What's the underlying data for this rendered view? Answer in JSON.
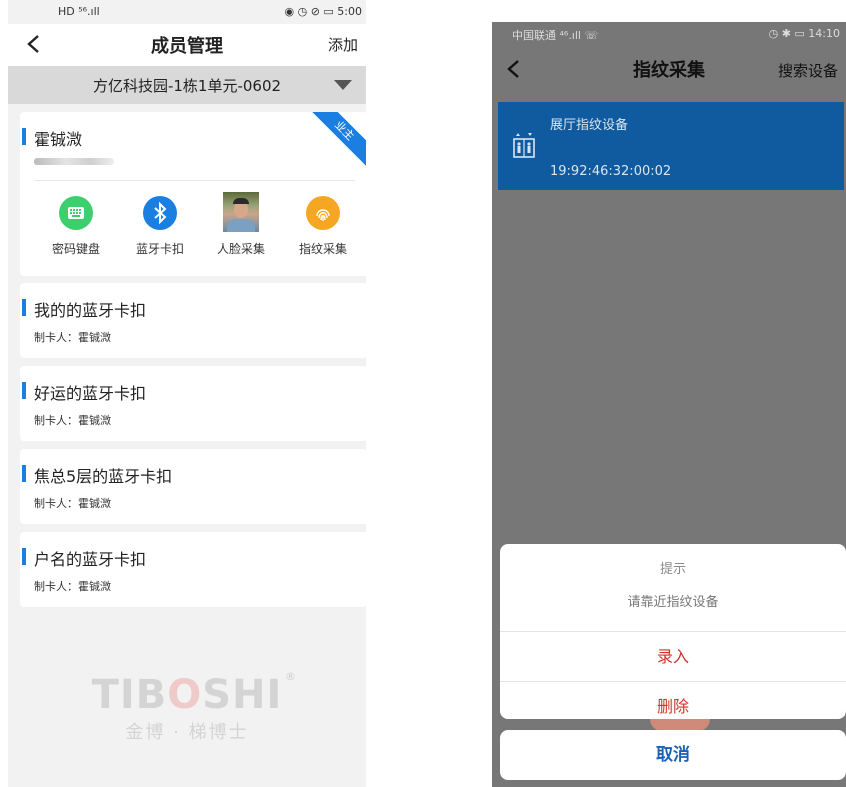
{
  "left": {
    "status": {
      "left": "HD ⁵⁶.ıll",
      "right": "◉ ◷ ⊘ ▭ 5:00"
    },
    "nav": {
      "title": "成员管理",
      "action": "添加"
    },
    "unit_select": "方亿科技园-1栋1单元-0602",
    "member": {
      "name": "霍铖溦",
      "badge": "业主",
      "functions": [
        {
          "label": "密码键盘",
          "icon": "keypad-icon",
          "color": "#3ccf6e"
        },
        {
          "label": "蓝牙卡扣",
          "icon": "bluetooth-icon",
          "color": "#1a7fe0"
        },
        {
          "label": "人脸采集",
          "icon": "face-photo"
        },
        {
          "label": "指纹采集",
          "icon": "fingerprint-icon",
          "color": "#f5a623"
        }
      ]
    },
    "cards": [
      {
        "title": "我的的蓝牙卡扣",
        "sub": "制卡人：霍铖溦"
      },
      {
        "title": "好运的蓝牙卡扣",
        "sub": "制卡人：霍铖溦"
      },
      {
        "title": "焦总5层的蓝牙卡扣",
        "sub": "制卡人：霍铖溦"
      },
      {
        "title": "户名的蓝牙卡扣",
        "sub": "制卡人：霍铖溦"
      }
    ],
    "watermark": {
      "logo_a": "TIB",
      "logo_o": "O",
      "logo_b": "SHI",
      "sub": "金博 · 梯博士",
      "reg": "®"
    }
  },
  "right": {
    "status": {
      "left": "中国联通 ⁴⁶.ıll ☏",
      "right": "◷ ✱ ▭ 14:10"
    },
    "nav": {
      "title": "指纹采集",
      "action": "搜索设备"
    },
    "device": {
      "name": "展厅指纹设备",
      "mac": "19:92:46:32:00:02"
    },
    "sheet": {
      "title": "提示",
      "message": "请靠近指纹设备",
      "options": [
        "录入",
        "删除"
      ],
      "cancel": "取消"
    }
  }
}
